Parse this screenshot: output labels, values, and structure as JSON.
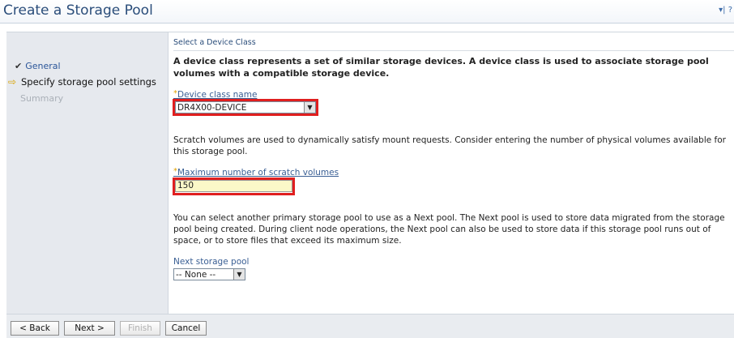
{
  "window": {
    "title": "Create a Storage Pool",
    "icons": "▾| ?"
  },
  "wizard": {
    "steps": [
      {
        "label": "General",
        "state": "done"
      },
      {
        "label": "Specify storage pool settings",
        "state": "current"
      },
      {
        "label": "Summary",
        "state": "pending"
      }
    ]
  },
  "main": {
    "step_title": "Select a Device Class",
    "description": "A device class represents a set of similar storage devices. A device class is used to associate storage pool volumes with a compatible storage device.",
    "device_class": {
      "label": "Device class name",
      "value": "DR4X00-DEVICE"
    },
    "scratch_text": "Scratch volumes are used to dynamically satisfy mount requests. Consider entering the number of physical volumes available for this storage pool.",
    "max_scratch": {
      "label": "Maximum number of scratch volumes",
      "value": "150"
    },
    "next_pool_text": "You can select another primary storage pool to use as a Next pool. The Next pool is used to store data migrated from the storage pool being created. During client node operations, the Next pool can also be used to store data if this storage pool runs out of space, or to store files that exceed its maximum size.",
    "next_pool": {
      "label": "Next storage pool",
      "value": "-- None --"
    }
  },
  "buttons": {
    "back": "< Back",
    "next": "Next >",
    "finish": "Finish",
    "cancel": "Cancel"
  },
  "colors": {
    "highlight": "#e01f1f",
    "title": "#2a4d7a",
    "nav_bg": "#e6e9ee"
  }
}
